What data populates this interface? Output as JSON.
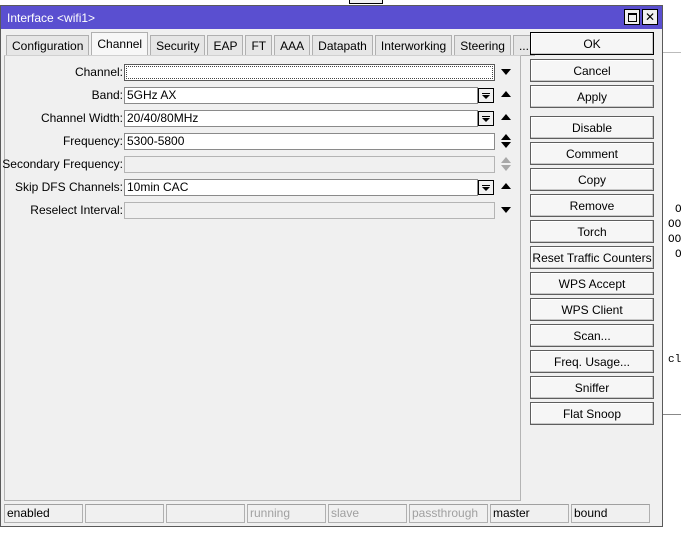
{
  "window": {
    "title": "Interface <wifi1>"
  },
  "tabs": [
    {
      "label": "Configuration",
      "active": false
    },
    {
      "label": "Channel",
      "active": true
    },
    {
      "label": "Security",
      "active": false
    },
    {
      "label": "EAP",
      "active": false
    },
    {
      "label": "FT",
      "active": false
    },
    {
      "label": "AAA",
      "active": false
    },
    {
      "label": "Datapath",
      "active": false
    },
    {
      "label": "Interworking",
      "active": false
    },
    {
      "label": "Steering",
      "active": false
    },
    {
      "label": "...",
      "active": false
    }
  ],
  "form": {
    "channel": {
      "label": "Channel:",
      "value": ""
    },
    "band": {
      "label": "Band:",
      "value": "5GHz AX"
    },
    "channel_width": {
      "label": "Channel Width:",
      "value": "20/40/80MHz"
    },
    "frequency": {
      "label": "Frequency:",
      "value": "5300-5800"
    },
    "secondary_frequency": {
      "label": "Secondary Frequency:",
      "value": ""
    },
    "skip_dfs_channels": {
      "label": "Skip DFS Channels:",
      "value": "10min CAC"
    },
    "reselect_interval": {
      "label": "Reselect Interval:",
      "value": ""
    }
  },
  "buttons": {
    "ok": "OK",
    "cancel": "Cancel",
    "apply": "Apply",
    "disable": "Disable",
    "comment": "Comment",
    "copy": "Copy",
    "remove": "Remove",
    "torch": "Torch",
    "reset_traffic_counters": "Reset Traffic Counters",
    "wps_accept": "WPS Accept",
    "wps_client": "WPS Client",
    "scan": "Scan...",
    "freq_usage": "Freq. Usage...",
    "sniffer": "Sniffer",
    "flat_snoop": "Flat Snoop"
  },
  "status_bar": {
    "enabled": "enabled",
    "empty1": "",
    "empty2": "",
    "running": "running",
    "slave": "slave",
    "passthrough": "passthrough",
    "master": "master",
    "bound": "bound"
  },
  "background": {
    "frag1": "O",
    "frag2": "OO",
    "frag3": "OO",
    "frag4": "O",
    "frag5": "cl"
  },
  "colors": {
    "titlebar": "#5a4fd0",
    "window_bg": "#f0f0f0",
    "disabled_text": "#a0a0a0"
  }
}
